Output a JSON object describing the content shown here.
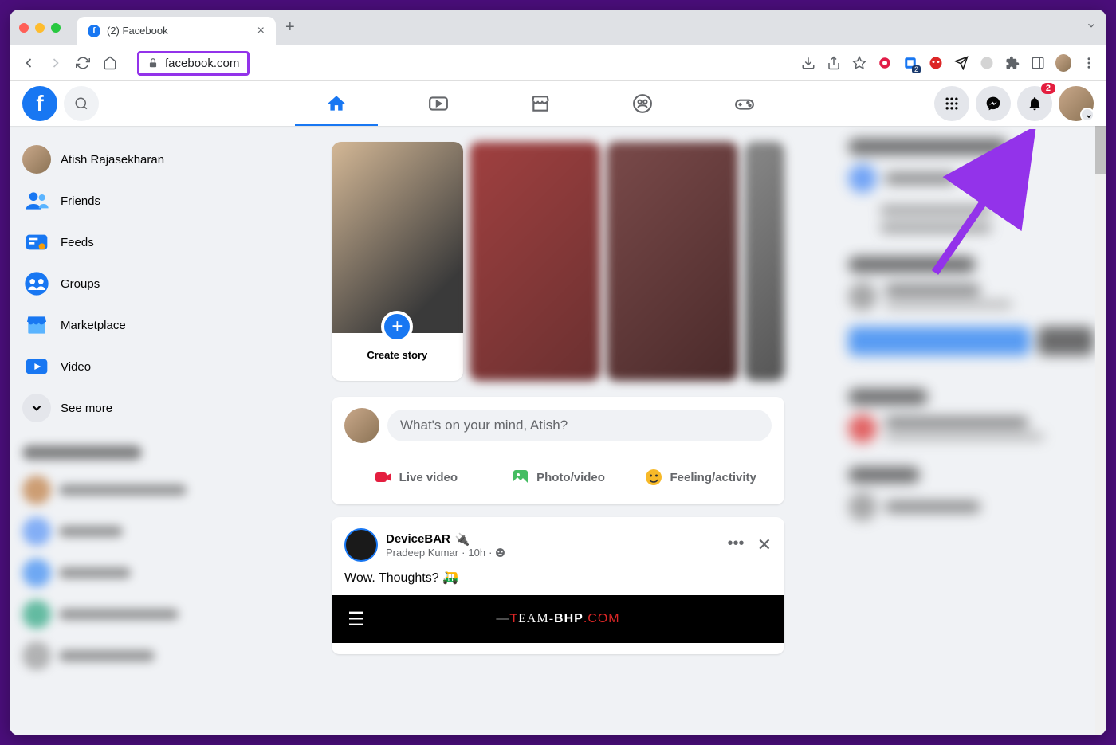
{
  "browser": {
    "tab_title": "(2) Facebook",
    "url": "facebook.com",
    "ext_badge": "2"
  },
  "header": {
    "notification_count": "2"
  },
  "sidebar": {
    "profile_name": "Atish Rajasekharan",
    "items": [
      {
        "label": "Friends"
      },
      {
        "label": "Feeds"
      },
      {
        "label": "Groups"
      },
      {
        "label": "Marketplace"
      },
      {
        "label": "Video"
      },
      {
        "label": "See more"
      }
    ]
  },
  "stories": {
    "create_label": "Create story"
  },
  "composer": {
    "placeholder": "What's on your mind, Atish?",
    "live_video": "Live video",
    "photo_video": "Photo/video",
    "feeling": "Feeling/activity"
  },
  "post": {
    "page_name": "DeviceBAR",
    "author": "Pradeep Kumar",
    "time": "10h",
    "text": "Wow. Thoughts? 🛺",
    "image_brand": "TEAM-BHP.COM"
  }
}
